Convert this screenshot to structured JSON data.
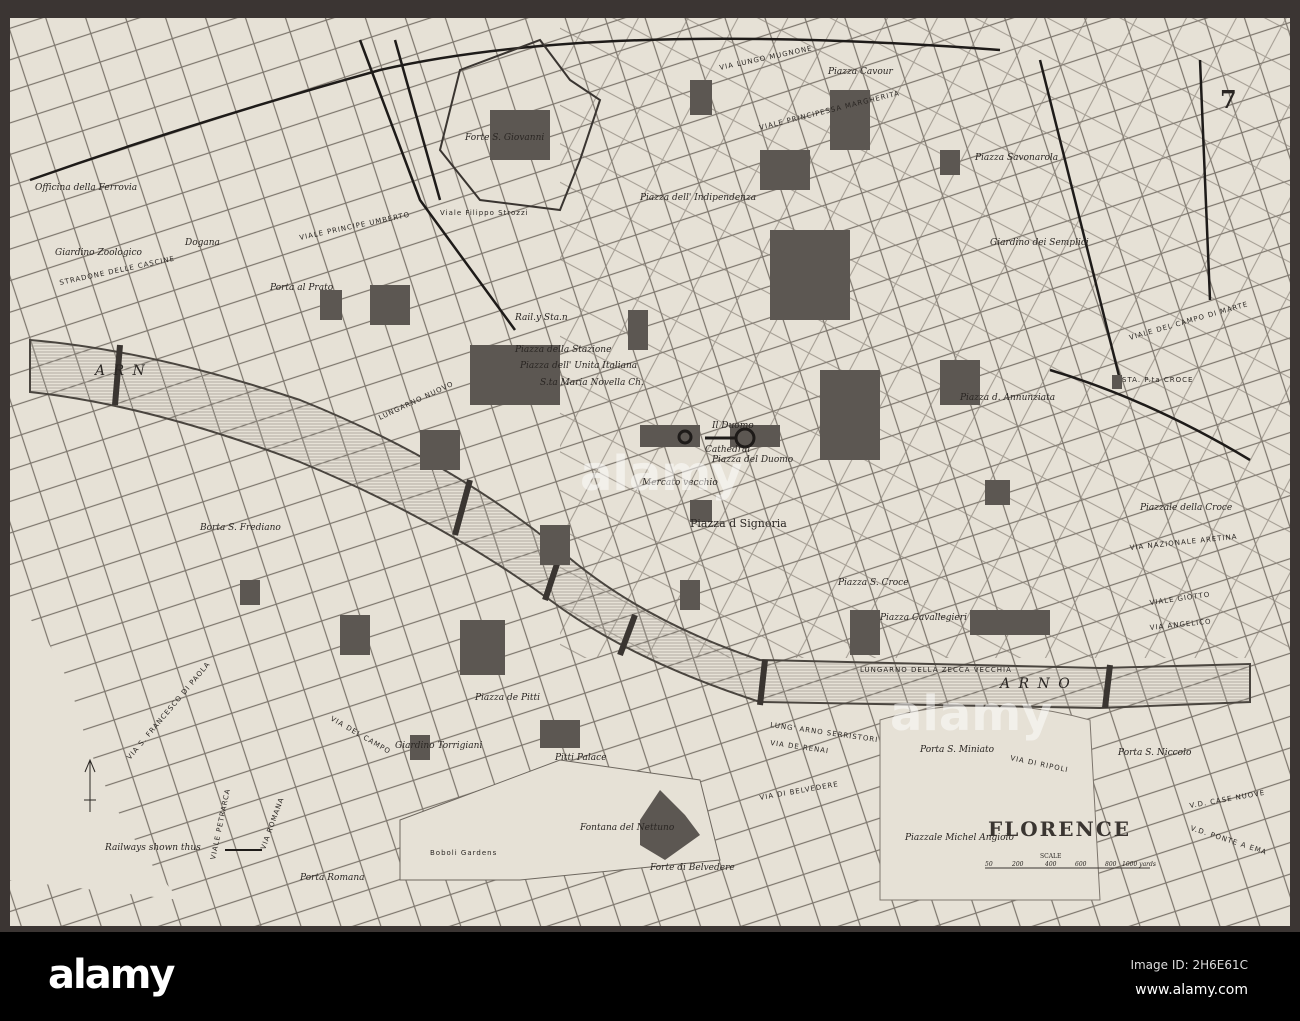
{
  "map": {
    "title": "FLORENCE",
    "plate_number": "7",
    "scale_label": "SCALE",
    "scale_ticks": [
      "50",
      "200",
      "400",
      "600",
      "800",
      "1000 yards"
    ],
    "legend_railway": "Railways shown thus",
    "river": [
      "A R N",
      "A R N O"
    ],
    "places": [
      "Piazza d Signoria",
      "Mercato vecchio",
      "Piazza del Duomo",
      "Cathedral",
      "Il Duomo",
      "Rail.y Sta.n",
      "Piazza della Stazione",
      "S.ta Maria Novella Ch.",
      "Piazza dell' Unita Italiana",
      "Forte S. Giovanni",
      "Viale Filippo Strozzi",
      "Piazza Cavour",
      "Piazza Savonarola",
      "Piazza dell' Indipendenza",
      "Piazza d. Annunziata",
      "Giardino dei Semplici",
      "STA. P.ta CROCE",
      "Piazzale della Croce",
      "Porta al Prato",
      "Giardino Zoologico",
      "Officina della Ferrovia",
      "Dogana",
      "Borta S. Frediano",
      "Porta Romana",
      "Pitti Palace",
      "Piazza de Pitti",
      "Boboli Gardens",
      "Fontana del Nettuno",
      "Forte di Belvedere",
      "Piazzale Michel Angiolo",
      "Porta S. Miniato",
      "Porta S. Niccolo",
      "Piazza S. Croce",
      "Giardino Torrigiani",
      "Piazza Cavallegieri"
    ],
    "streets": [
      "VIALE PRINCIPE UMBERTO",
      "VIALE PRINCIPESSA MARGHERITA",
      "VIA LUNGO MUGNONE",
      "LUNGARNO DELLA ZECCA VECCHIA",
      "LUNG' ARNO SERRISTORI",
      "VIA DE RENAI",
      "VIA DI BELVEDERE",
      "VIA DI RIPOLI",
      "VIA NAZIONALE ARETINA",
      "VIALE DEL CAMPO DI MARTE",
      "VIA ROMANA",
      "VIALE PETRARCA",
      "VIA S. FRANCESCO DI PAOLA",
      "VIA DEL CAMPO",
      "STRADONE DELLE CASCINE",
      "LUNGARNO NUOVO",
      "VIALE GIOTTO",
      "VIA ANGELICO",
      "V.D. CASE NUOVE",
      "V.D. PONTE A EMA"
    ]
  },
  "footer": {
    "logo": "alamy",
    "watermark": "alamy",
    "image_id": "Image ID: 2H6E61C",
    "url": "www.alamy.com"
  }
}
